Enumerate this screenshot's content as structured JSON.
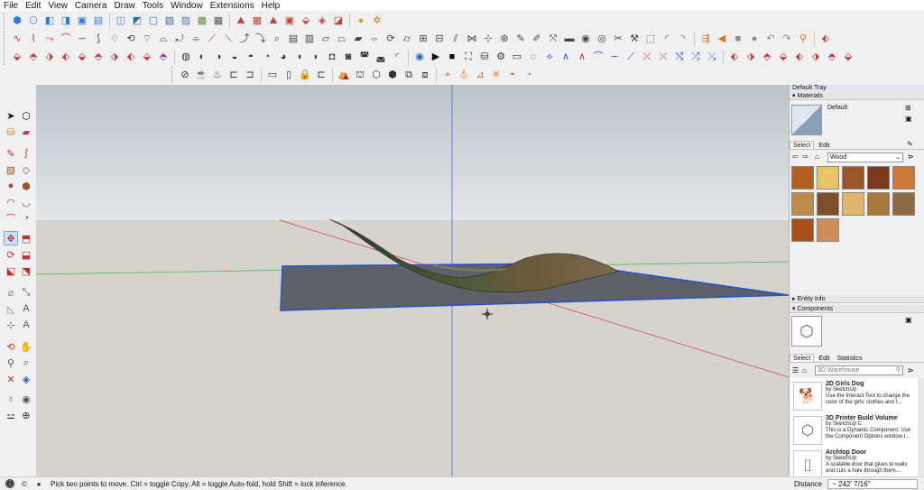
{
  "menu": [
    "File",
    "Edit",
    "View",
    "Camera",
    "Draw",
    "Tools",
    "Window",
    "Extensions",
    "Help"
  ],
  "tray": {
    "title": "Default Tray",
    "materials_header": "Materials",
    "current_material": "Default",
    "tabs": [
      "Select",
      "Edit"
    ],
    "library": "Wood",
    "swatch_colors": [
      "#b45f22",
      "#e5c46a",
      "#9a5628",
      "#7a3b1d",
      "#c97b37",
      "#c08a4a",
      "#7d4e2a",
      "#e0b86c",
      "#a8783c",
      "#8c6a45",
      "#a8501c",
      "#cc8c5c"
    ],
    "entity_info_header": "Entity Info",
    "components_header": "Components",
    "comp_tabs": [
      "Select",
      "Edit",
      "Statistics"
    ],
    "search_placeholder": "3D Warehouse",
    "components": [
      {
        "title": "2D Girls Dog",
        "author": "by SketchUp",
        "desc": "Use the Interact Tool to change the color of the girls' clothes and t..."
      },
      {
        "title": "3D Printer Build Volume",
        "author": "by SketchUp C",
        "desc": "This is a Dynamic Component. Use the Component Options window t..."
      },
      {
        "title": "Archtop Door",
        "author": "by SketchUp",
        "desc": "A scalable door that glues to walls and cuts a hole through them..."
      }
    ]
  },
  "status": {
    "hint": "Pick two points to move.  Ctrl = toggle Copy, Alt = toggle Auto-fold, hold Shift = lock inference.",
    "measure_label": "Distance",
    "measure_value": "~ 242' 7/16\""
  },
  "colors": {
    "accent": "#2a53c8",
    "axis_red": "#d84040",
    "axis_green": "#3bbf3b",
    "axis_blue": "#4a6ad8",
    "ground": "#d6d3cf"
  }
}
